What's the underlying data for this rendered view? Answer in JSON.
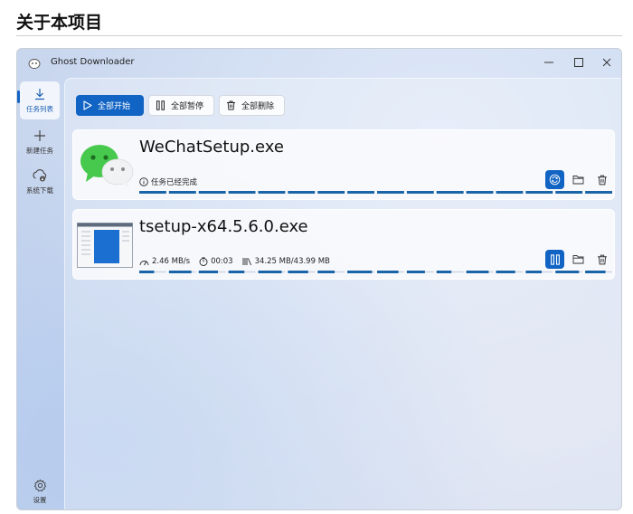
{
  "page": {
    "heading": "关于本项目"
  },
  "window": {
    "title": "Ghost Downloader",
    "controls": {
      "minimize": "—",
      "maximize": "☐",
      "close": "✕"
    }
  },
  "sidebar": {
    "items": [
      {
        "label": "任务列表",
        "icon": "download-icon",
        "active": true
      },
      {
        "label": "新建任务",
        "icon": "plus-icon"
      },
      {
        "label": "系统下载",
        "icon": "cloud-download-icon"
      }
    ],
    "settings": {
      "label": "设置",
      "icon": "gear-icon"
    }
  },
  "toolbar": {
    "start_all": "全部开始",
    "pause_all": "全部暂停",
    "delete_all": "全部删除"
  },
  "tasks": [
    {
      "file_name": "WeChatSetup.exe",
      "status": "任务已经完成",
      "icon": "wechat-icon",
      "progress": 1.0
    },
    {
      "file_name": "tsetup-x64.5.6.0.exe",
      "speed": "2.46 MB/s",
      "time_left": "00:03",
      "size": "34.25 MB/43.99 MB",
      "icon": "installer-icon",
      "progress": 0.78
    }
  ],
  "colors": {
    "accent": "#1264c4",
    "track": "#1a64a8"
  }
}
